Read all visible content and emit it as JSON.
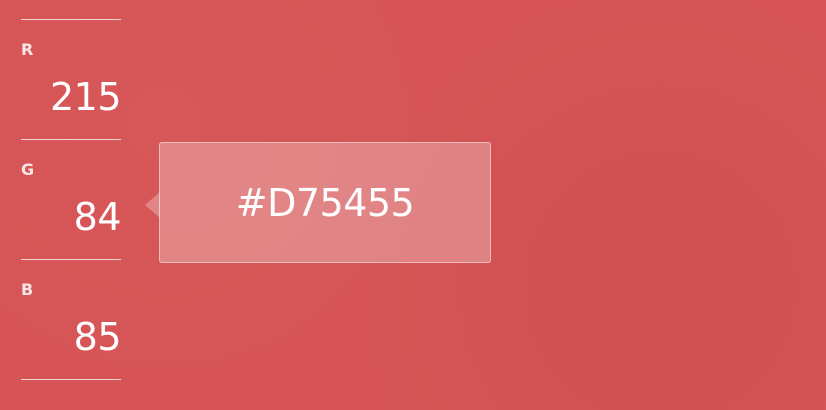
{
  "background_color": "#D65455",
  "channels": [
    {
      "label": "R",
      "value": "215"
    },
    {
      "label": "G",
      "value": "84"
    },
    {
      "label": "B",
      "value": "85"
    }
  ],
  "hex": {
    "value": "#D75455"
  }
}
